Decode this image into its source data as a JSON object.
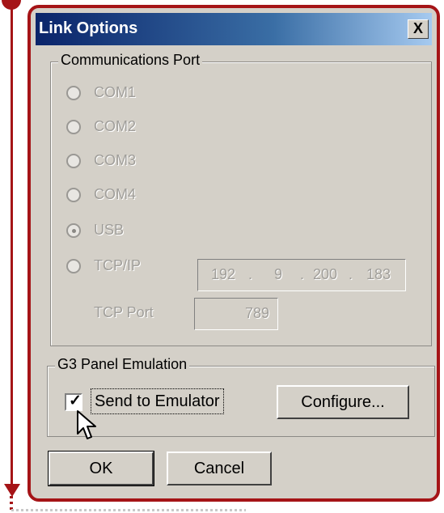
{
  "dialog": {
    "title": "Link Options",
    "close_glyph": "X"
  },
  "comm_port": {
    "legend": "Communications Port",
    "options": [
      {
        "label": "COM1",
        "selected": false
      },
      {
        "label": "COM2",
        "selected": false
      },
      {
        "label": "COM3",
        "selected": false
      },
      {
        "label": "COM4",
        "selected": false
      },
      {
        "label": "USB",
        "selected": true
      },
      {
        "label": "TCP/IP",
        "selected": false
      }
    ],
    "ip": {
      "a": "192",
      "b": "9",
      "c": "200",
      "d": "183",
      "dot": "."
    },
    "tcp_port_label": "TCP Port",
    "tcp_port_value": "789"
  },
  "emulation": {
    "legend": "G3 Panel Emulation",
    "send_label": "Send to Emulator",
    "send_checked": true,
    "check_glyph": "✓",
    "configure_label": "Configure..."
  },
  "buttons": {
    "ok": "OK",
    "cancel": "Cancel"
  },
  "colors": {
    "accent_red": "#a51417",
    "dialog_bg": "#d4d0c8",
    "titlebar_dark": "#0a246a"
  }
}
